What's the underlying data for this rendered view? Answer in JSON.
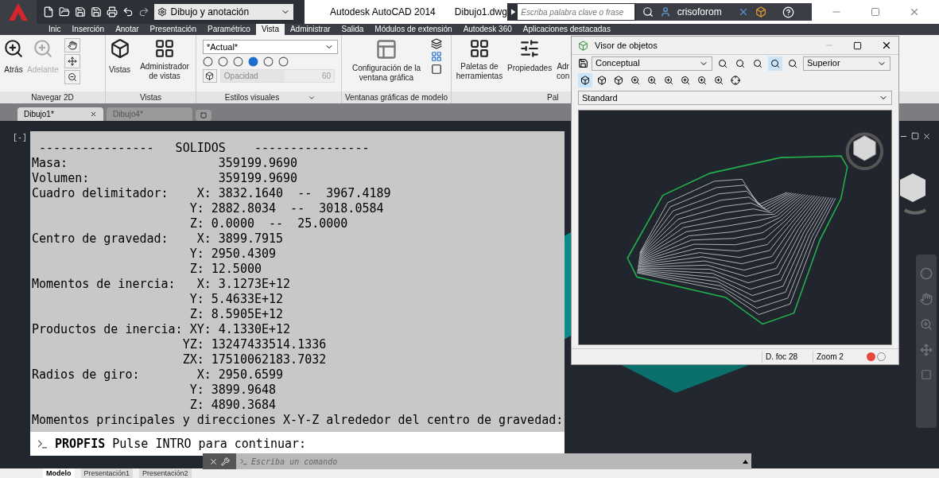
{
  "title_bar": {
    "workspace": "Dibujo y anotación",
    "app_title": "Autodesk AutoCAD 2014",
    "file_name": "Dibujo1.dwg",
    "search": {
      "placeholder": "Escriba palabra clave o frase"
    },
    "user": "crisoforom"
  },
  "ribbon_tabs": [
    {
      "label": "Inic",
      "selected": false
    },
    {
      "label": "Inserción",
      "selected": false
    },
    {
      "label": "Anotar",
      "selected": false
    },
    {
      "label": "Presentación",
      "selected": false
    },
    {
      "label": "Paramétrico",
      "selected": false
    },
    {
      "label": "Vista",
      "selected": true
    },
    {
      "label": "Administrar",
      "selected": false
    },
    {
      "label": "Salida",
      "selected": false
    },
    {
      "label": "Módulos de extensión",
      "selected": false
    },
    {
      "label": "Autodesk 360",
      "selected": false
    },
    {
      "label": "Aplicaciones destacadas",
      "selected": false
    }
  ],
  "ribbon": {
    "navegar": {
      "title": "Navegar 2D",
      "buttons": [
        {
          "label": "Atrás",
          "disabled": false
        },
        {
          "label": "Adelante",
          "disabled": true
        }
      ]
    },
    "vistas": {
      "title": "Vistas",
      "buttons": [
        "Vistas",
        "Administrador de vistas"
      ]
    },
    "estilos": {
      "title": "Estilos visuales",
      "style": "*Actual*",
      "opacity": {
        "placeholder": "Opacidad",
        "value": "60"
      }
    },
    "ventanas": {
      "title": "Ventanas gráficas de modelo",
      "button": "Configuración de la ventana gráfica"
    },
    "paletas": {
      "title": "Pal",
      "buttons": [
        "Paletas de herramientas",
        "Propiedades",
        "Adr con"
      ]
    }
  },
  "doc_tabs": [
    {
      "label": "Dibujo1*",
      "selected": true
    },
    {
      "label": "Dibujo4*",
      "selected": false
    }
  ],
  "viewport_control": "[-]",
  "text_window": {
    "lines": [
      " ----------------   SOLIDOS    ----------------",
      "Masa:                     359199.9690",
      "Volumen:                  359199.9690",
      "Cuadro delimitador:    X: 3832.1640  --  3967.4189",
      "                      Y: 2882.8034  --  3018.0584",
      "                      Z: 0.0000  --  25.0000",
      "Centro de gravedad:    X: 3899.7915",
      "                      Y: 2950.4309",
      "                      Z: 12.5000",
      "Momentos de inercia:   X: 3.1273E+12",
      "                      Y: 5.4633E+12",
      "                      Z: 8.5905E+12",
      "Productos de inercia: XY: 4.1330E+12",
      "                     YZ: 13247433514.1336",
      "                     ZX: 17510062183.7032",
      "Radios de giro:        X: 2950.6599",
      "                      Y: 3899.9648",
      "                      Z: 4890.3684",
      "Momentos principales y direcciones X-Y-Z alrededor del centro de gravedad:"
    ]
  },
  "command_line": "**PROPFIS** Pulse INTRO para continuar:",
  "command_input": {
    "placeholder": "Escriba un comando"
  },
  "layout_tabs": [
    {
      "label": "Modelo",
      "selected": true
    },
    {
      "label": "Presentación1",
      "selected": false
    },
    {
      "label": "Presentación2",
      "selected": false
    }
  ],
  "object_viewer": {
    "title": "Visor de objetos",
    "visual_style": "Conceptual",
    "view": "Superior",
    "ucs": "Standard",
    "status": [
      "D. foc 28",
      "Zoom 2"
    ]
  }
}
